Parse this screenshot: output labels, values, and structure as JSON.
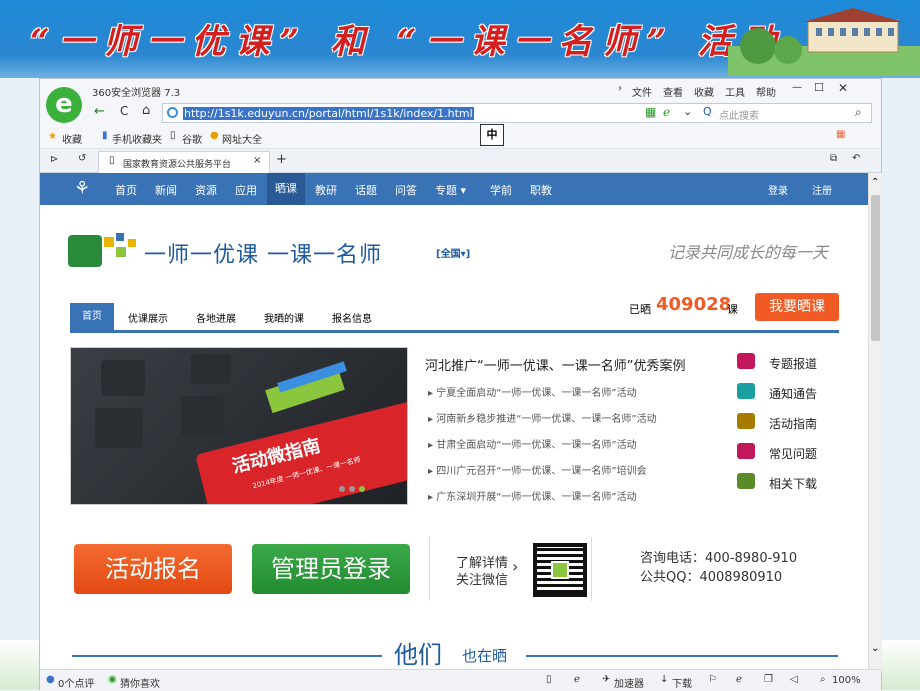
{
  "slide": {
    "title": "“一师一优课” 和 “一课一名师” 活动"
  },
  "browser": {
    "title": "360安全浏览器 7.3",
    "menu": [
      "文件",
      "查看",
      "收藏",
      "工具",
      "帮助"
    ],
    "url": "http://1s1k.eduyun.cn/portal/html/1s1k/index/1.html",
    "search_placeholder": "点此搜索",
    "ime": "中",
    "favorites": [
      "收藏",
      "手机收藏夹",
      "谷歌",
      "网址大全"
    ],
    "tab": "国家教育资源公共服务平台",
    "status": {
      "comments": "0个点评",
      "guess": "猜你喜欢",
      "accelerator": "加速器",
      "download": "下载",
      "zoom": "100%"
    }
  },
  "site": {
    "nav": [
      "首页",
      "新闻",
      "资源",
      "应用",
      "晒课",
      "教研",
      "话题",
      "问答",
      "专题 ▾",
      "学前",
      "职教"
    ],
    "login": "登录",
    "register": "注册",
    "logo_title": "一师一优课 一课一名师",
    "scope": "[全国▾]",
    "slogan": "记录共同成长的每一天",
    "tabs": [
      "首页",
      "优课展示",
      "各地进展",
      "我晒的课",
      "报名信息"
    ],
    "count_prefix": "已晒",
    "count": "409028",
    "count_suffix": "课",
    "share_button": "我要晒课",
    "banner_text": "活动微指南",
    "banner_sub": "2014年度 一师一优课、一课一名师",
    "headline": "河北推广“一师一优课、一课一名师”优秀案例",
    "news": [
      "宁夏全面启动“一师一优课、一课一名师”活动",
      "河南新乡稳步推进“一师一优课、一课一名师”活动",
      "甘肃全面启动“一师一优课、一课一名师”活动",
      "四川广元召开“一师一优课、一课一名师”培训会",
      "广东深圳开展“一师一优课、一课一名师”活动"
    ],
    "side": [
      "专题报道",
      "通知通告",
      "活动指南",
      "常见问题",
      "相关下载"
    ],
    "signup": "活动报名",
    "admin": "管理员登录",
    "wechat1": "了解详情",
    "wechat2": "关注微信",
    "phone": "咨询电话：400-8980-910",
    "qq": "公共QQ：4008980910",
    "they": "他们",
    "also": "也在晒"
  },
  "colors": {
    "nav": "#3a73b5",
    "orange": "#f15a24",
    "green": "#2e9a3c",
    "red": "#d51f1f"
  }
}
